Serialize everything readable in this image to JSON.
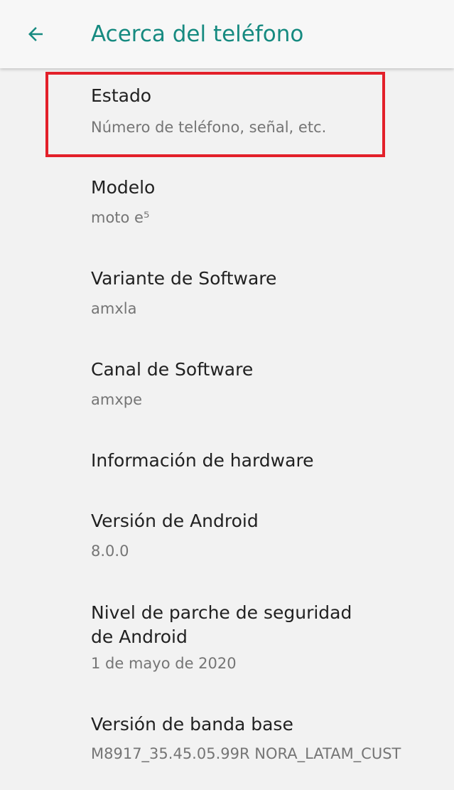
{
  "appbar": {
    "title": "Acerca del teléfono",
    "back_icon": "arrow-left-icon",
    "accent_color": "#168a80"
  },
  "items": [
    {
      "title": "Estado",
      "summary": "Número de teléfono, señal, etc."
    },
    {
      "title": "Modelo",
      "summary": "moto e⁵"
    },
    {
      "title": "Variante de Software",
      "summary": "amxla"
    },
    {
      "title": "Canal de Software",
      "summary": "amxpe"
    },
    {
      "title": "Información de hardware",
      "summary": ""
    },
    {
      "title": "Versión de Android",
      "summary": "8.0.0"
    },
    {
      "title": "Nivel de parche de seguridad de Android",
      "summary": "1 de mayo de 2020"
    },
    {
      "title": "Versión de banda base",
      "summary": "M8917_35.45.05.99R NORA_LATAM_CUST"
    }
  ],
  "highlight": {
    "target": "Estado",
    "color": "#e3202a"
  }
}
